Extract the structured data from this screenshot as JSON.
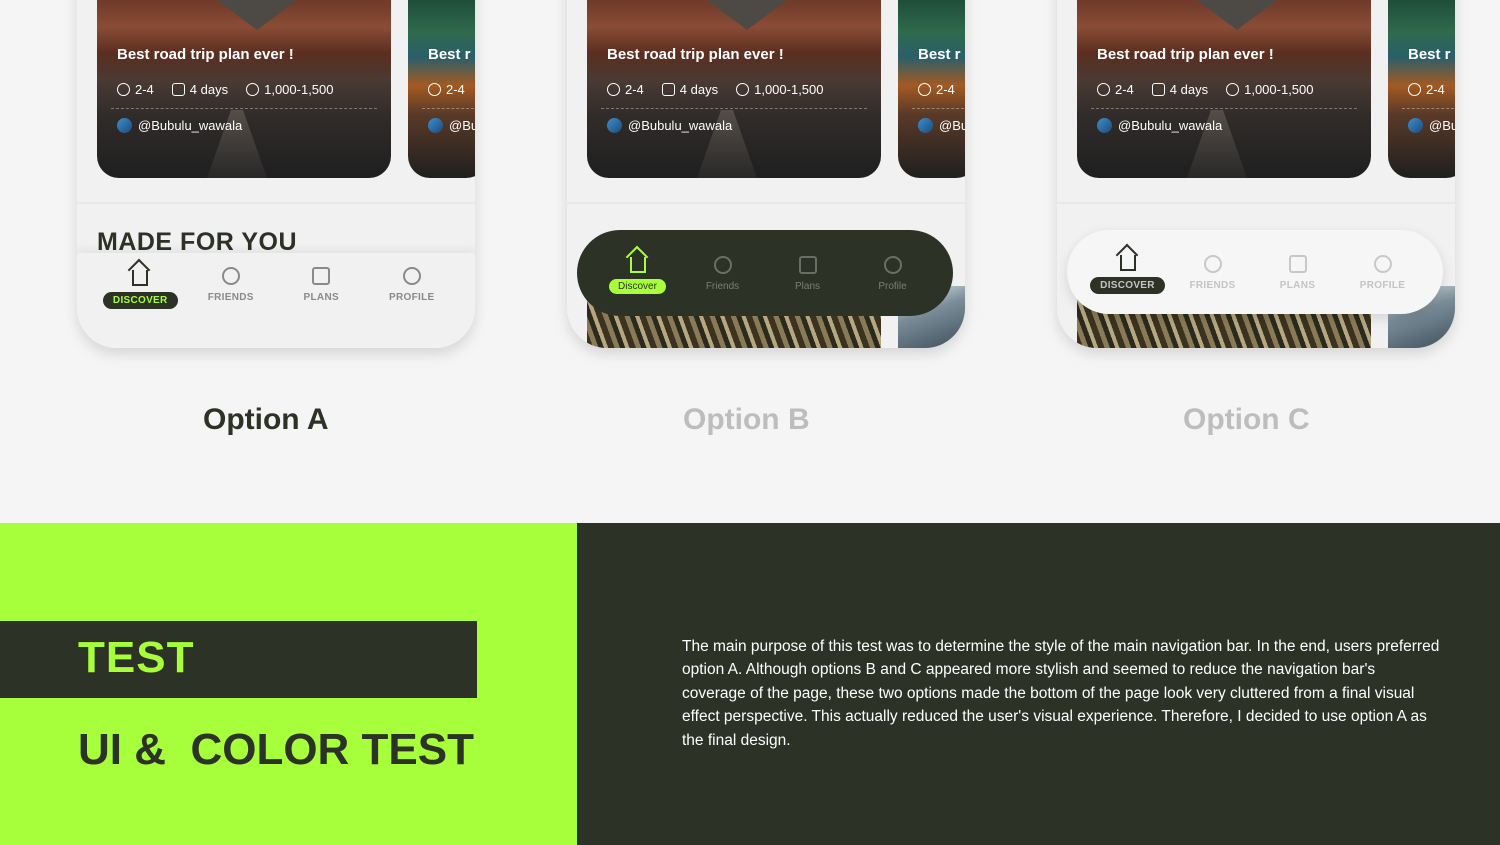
{
  "colors": {
    "accent": "#a6ff3a",
    "dark": "#2d3226",
    "background": "#f5f5f5"
  },
  "card": {
    "title": "Best road trip plan ever !",
    "title_partial": "Best r",
    "people": "2-4",
    "days": "4 days",
    "budget": "1,000-1,500",
    "user": "@Bubulu_wawala",
    "user_partial": "@Bu",
    "icons": [
      "people-icon",
      "calendar-icon",
      "dollar-icon"
    ]
  },
  "section_title": "MADE FOR YOU",
  "nav_a": {
    "discover": "DISCOVER",
    "friends": "FRIENDS",
    "plans": "PLANS",
    "profile": "PROFILE"
  },
  "nav_b": {
    "discover": "Discover",
    "friends": "Friends",
    "plans": "Plans",
    "profile": "Profile"
  },
  "nav_c": {
    "discover": "DISCOVER",
    "friends": "FRIENDS",
    "plans": "PLANS",
    "profile": "PROFILE"
  },
  "options": {
    "a": "Option A",
    "b": "Option B",
    "c": "Option C"
  },
  "panel": {
    "test": "TEST",
    "title": "UI &  COLOR TEST",
    "description": "The main purpose of this test was to determine the style of the main navigation bar. In the end, users preferred option A. Although options B and C appeared more stylish and seemed to reduce the navigation bar's coverage of the page, these two options made the bottom of the page look very cluttered from a final visual effect perspective. This actually reduced the user's visual experience. Therefore, I decided to use option A as the final design."
  }
}
